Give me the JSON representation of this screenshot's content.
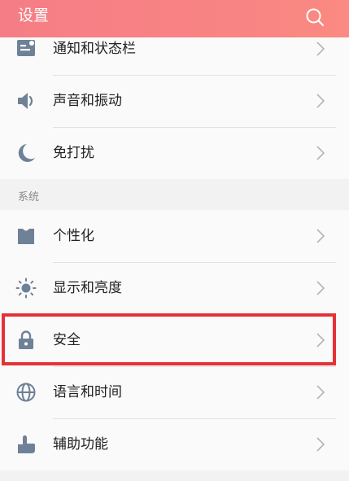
{
  "header": {
    "title": "设置",
    "search_icon": "search-icon",
    "gradient_colors": [
      "#f57e86",
      "#fa8a82"
    ]
  },
  "groups": [
    {
      "items": [
        {
          "label": "通知和状态栏",
          "icon": "notification-bar-icon"
        },
        {
          "label": "声音和振动",
          "icon": "speaker-icon"
        },
        {
          "label": "免打扰",
          "icon": "moon-icon"
        }
      ]
    },
    {
      "section_label": "系统",
      "items": [
        {
          "label": "个性化",
          "icon": "personalization-icon"
        },
        {
          "label": "显示和亮度",
          "icon": "brightness-icon"
        },
        {
          "label": "安全",
          "icon": "lock-icon",
          "highlighted": true
        },
        {
          "label": "语言和时间",
          "icon": "globe-icon"
        },
        {
          "label": "辅助功能",
          "icon": "accessibility-hand-icon"
        }
      ]
    }
  ],
  "colors": {
    "icon": "#6e8196",
    "highlight_border": "#e43237",
    "chevron": "#b5b5b5"
  }
}
